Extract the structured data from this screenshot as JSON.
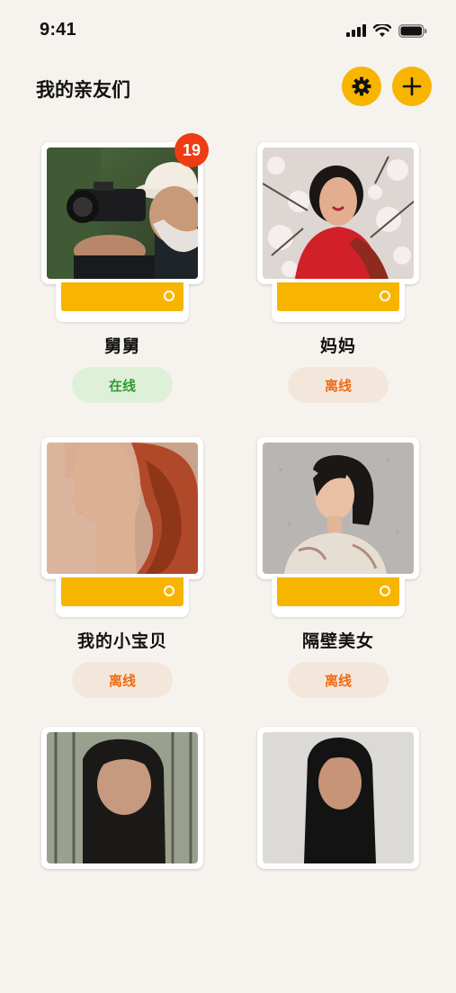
{
  "status_bar": {
    "time": "9:41"
  },
  "header": {
    "title": "我的亲友们",
    "settings_icon": "gear-icon",
    "add_icon": "plus-icon"
  },
  "colors": {
    "accent": "#f7b500",
    "badge": "#ee3d13",
    "online": "#2f9b2f",
    "offline": "#ee6a12"
  },
  "contacts": [
    {
      "name": "舅舅",
      "status": "在线",
      "badge": "19"
    },
    {
      "name": "妈妈",
      "status": "离线"
    },
    {
      "name": "我的小宝贝",
      "status": "离线"
    },
    {
      "name": "隔壁美女",
      "status": "离线"
    },
    {
      "name": ""
    },
    {
      "name": ""
    }
  ]
}
